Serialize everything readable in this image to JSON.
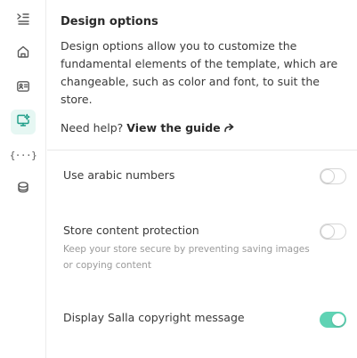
{
  "sidebar": {
    "items": [
      {
        "icon": "indent-icon"
      },
      {
        "icon": "home-icon"
      },
      {
        "icon": "id-card-icon"
      },
      {
        "icon": "monitor-settings-icon",
        "active": true
      },
      {
        "icon": "curly-braces-icon",
        "glyph": "{···}"
      },
      {
        "icon": "package-icon"
      }
    ],
    "active_color": "#1a9c86",
    "active_bg": "#e6f7f3"
  },
  "header": {
    "title": "Design options",
    "description": "Design options allow you to customize the fundamental elements of the template, which are changeable, such as color and font, to suit the store.",
    "help_prefix": "Need help?",
    "help_link": "View the guide",
    "help_icon": "share-arrow-icon"
  },
  "settings": [
    {
      "label": "Use arabic numbers",
      "enabled": false
    },
    {
      "label": "Store content protection",
      "sublabel": "Keep your store secure by preventing saving images or copying content",
      "enabled": false
    },
    {
      "label": "Display Salla copyright message",
      "enabled": true
    }
  ],
  "colors": {
    "toggle_on": "#5fd3b4",
    "toggle_off_border": "#d6d6d6"
  }
}
